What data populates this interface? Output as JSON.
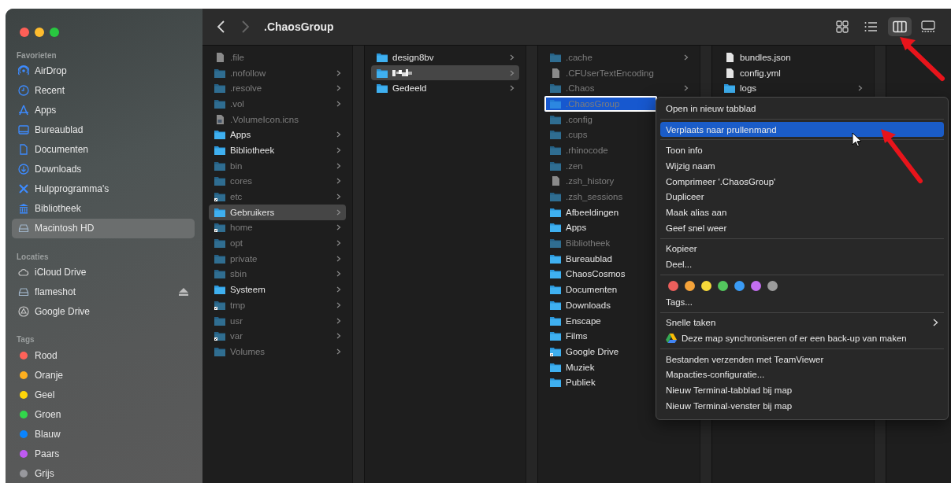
{
  "window": {
    "title": ".ChaosGroup"
  },
  "toolbar": {
    "back_enabled": true,
    "forward_enabled": false,
    "views": [
      {
        "kind": "icons",
        "selected": false
      },
      {
        "kind": "list",
        "selected": false
      },
      {
        "kind": "columns",
        "selected": true
      },
      {
        "kind": "gallery",
        "selected": false
      }
    ]
  },
  "sidebar": {
    "sections": [
      {
        "heading": "Favorieten",
        "items": [
          {
            "label": "AirDrop",
            "kind": "airdrop",
            "selected": false
          },
          {
            "label": "Recent",
            "kind": "recent",
            "selected": false
          },
          {
            "label": "Apps",
            "kind": "apps",
            "selected": false
          },
          {
            "label": "Bureaublad",
            "kind": "desktop",
            "selected": false
          },
          {
            "label": "Documenten",
            "kind": "document",
            "selected": false
          },
          {
            "label": "Downloads",
            "kind": "download",
            "selected": false
          },
          {
            "label": "Hulpprogramma's",
            "kind": "tools",
            "selected": false
          },
          {
            "label": "Bibliotheek",
            "kind": "library",
            "selected": false
          },
          {
            "label": "Macintosh HD",
            "kind": "disk",
            "selected": true
          }
        ]
      },
      {
        "heading": "Locaties",
        "items": [
          {
            "label": "iCloud Drive",
            "kind": "cloud",
            "selected": false,
            "ejectable": false
          },
          {
            "label": "flameshot",
            "kind": "disk",
            "selected": false,
            "ejectable": true
          },
          {
            "label": "Google Drive",
            "kind": "drive",
            "selected": false,
            "ejectable": false
          }
        ]
      },
      {
        "heading": "Tags",
        "items": [
          {
            "label": "Rood",
            "kind": "tag",
            "color": "#ff6259",
            "selected": false
          },
          {
            "label": "Oranje",
            "kind": "tag",
            "color": "#ffb01f",
            "selected": false
          },
          {
            "label": "Geel",
            "kind": "tag",
            "color": "#ffd60a",
            "selected": false
          },
          {
            "label": "Groen",
            "kind": "tag",
            "color": "#32d74b",
            "selected": false
          },
          {
            "label": "Blauw",
            "kind": "tag",
            "color": "#0a84ff",
            "selected": false
          },
          {
            "label": "Paars",
            "kind": "tag",
            "color": "#bf5af2",
            "selected": false
          },
          {
            "label": "Grijs",
            "kind": "tag",
            "color": "#98989d",
            "selected": false
          }
        ]
      }
    ]
  },
  "columns": [
    {
      "items": [
        {
          "name": ".file",
          "kind": "file",
          "dimmed": true,
          "alias": false,
          "has_children": false,
          "selected": false,
          "focused": false
        },
        {
          "name": ".nofollow",
          "kind": "folder",
          "dimmed": true,
          "alias": false,
          "has_children": true,
          "selected": false,
          "focused": false
        },
        {
          "name": ".resolve",
          "kind": "folder",
          "dimmed": true,
          "alias": false,
          "has_children": true,
          "selected": false,
          "focused": false
        },
        {
          "name": ".vol",
          "kind": "folder",
          "dimmed": true,
          "alias": false,
          "has_children": true,
          "selected": false,
          "focused": false
        },
        {
          "name": ".VolumeIcon.icns",
          "kind": "image-file",
          "dimmed": true,
          "alias": false,
          "has_children": false,
          "selected": false,
          "focused": false
        },
        {
          "name": "Apps",
          "kind": "folder",
          "dimmed": false,
          "alias": false,
          "has_children": true,
          "selected": false,
          "focused": false
        },
        {
          "name": "Bibliotheek",
          "kind": "folder",
          "dimmed": false,
          "alias": false,
          "has_children": true,
          "selected": false,
          "focused": false
        },
        {
          "name": "bin",
          "kind": "folder",
          "dimmed": true,
          "alias": false,
          "has_children": true,
          "selected": false,
          "focused": false
        },
        {
          "name": "cores",
          "kind": "folder",
          "dimmed": true,
          "alias": false,
          "has_children": true,
          "selected": false,
          "focused": false
        },
        {
          "name": "etc",
          "kind": "folder",
          "dimmed": true,
          "alias": true,
          "has_children": true,
          "selected": false,
          "focused": false
        },
        {
          "name": "Gebruikers",
          "kind": "folder",
          "dimmed": false,
          "alias": false,
          "has_children": true,
          "selected": true,
          "focused": false
        },
        {
          "name": "home",
          "kind": "folder",
          "dimmed": true,
          "alias": true,
          "has_children": true,
          "selected": false,
          "focused": false
        },
        {
          "name": "opt",
          "kind": "folder",
          "dimmed": true,
          "alias": false,
          "has_children": true,
          "selected": false,
          "focused": false
        },
        {
          "name": "private",
          "kind": "folder",
          "dimmed": true,
          "alias": false,
          "has_children": true,
          "selected": false,
          "focused": false
        },
        {
          "name": "sbin",
          "kind": "folder",
          "dimmed": true,
          "alias": false,
          "has_children": true,
          "selected": false,
          "focused": false
        },
        {
          "name": "Systeem",
          "kind": "folder",
          "dimmed": false,
          "alias": false,
          "has_children": true,
          "selected": false,
          "focused": false
        },
        {
          "name": "tmp",
          "kind": "folder",
          "dimmed": true,
          "alias": true,
          "has_children": true,
          "selected": false,
          "focused": false
        },
        {
          "name": "usr",
          "kind": "folder",
          "dimmed": true,
          "alias": false,
          "has_children": true,
          "selected": false,
          "focused": false
        },
        {
          "name": "var",
          "kind": "folder",
          "dimmed": true,
          "alias": true,
          "has_children": true,
          "selected": false,
          "focused": false
        },
        {
          "name": "Volumes",
          "kind": "folder",
          "dimmed": true,
          "alias": false,
          "has_children": true,
          "selected": false,
          "focused": false
        }
      ]
    },
    {
      "items": [
        {
          "name": "design8bv",
          "kind": "folder",
          "dimmed": false,
          "alias": false,
          "has_children": true,
          "selected": false,
          "focused": false
        },
        {
          "kind": "redacted-folder",
          "dimmed": false,
          "alias": false,
          "has_children": true,
          "selected": true,
          "focused": false
        },
        {
          "name": "Gedeeld",
          "kind": "folder",
          "dimmed": false,
          "alias": false,
          "has_children": true,
          "selected": false,
          "focused": false
        }
      ]
    },
    {
      "items": [
        {
          "name": ".cache",
          "kind": "folder",
          "dimmed": true,
          "alias": false,
          "has_children": true,
          "selected": false,
          "focused": false
        },
        {
          "name": ".CFUserTextEncoding",
          "kind": "file",
          "dimmed": true,
          "alias": false,
          "has_children": false,
          "selected": false,
          "focused": false
        },
        {
          "name": ".Chaos",
          "kind": "folder",
          "dimmed": true,
          "alias": false,
          "has_children": true,
          "selected": false,
          "focused": false
        },
        {
          "name": ".ChaosGroup",
          "kind": "folder",
          "dimmed": true,
          "alias": false,
          "has_children": false,
          "selected": true,
          "focused": true
        },
        {
          "name": ".config",
          "kind": "folder",
          "dimmed": true,
          "alias": false,
          "has_children": false,
          "selected": false,
          "focused": false
        },
        {
          "name": ".cups",
          "kind": "folder",
          "dimmed": true,
          "alias": false,
          "has_children": false,
          "selected": false,
          "focused": false
        },
        {
          "name": ".rhinocode",
          "kind": "folder",
          "dimmed": true,
          "alias": false,
          "has_children": false,
          "selected": false,
          "focused": false
        },
        {
          "name": ".zen",
          "kind": "folder",
          "dimmed": true,
          "alias": false,
          "has_children": false,
          "selected": false,
          "focused": false
        },
        {
          "name": ".zsh_history",
          "kind": "file",
          "dimmed": true,
          "alias": false,
          "has_children": false,
          "selected": false,
          "focused": false
        },
        {
          "name": ".zsh_sessions",
          "kind": "folder",
          "dimmed": true,
          "alias": false,
          "has_children": false,
          "selected": false,
          "focused": false
        },
        {
          "name": "Afbeeldingen",
          "kind": "folder",
          "dimmed": false,
          "alias": false,
          "has_children": false,
          "selected": false,
          "focused": false
        },
        {
          "name": "Apps",
          "kind": "folder",
          "dimmed": false,
          "alias": false,
          "has_children": false,
          "selected": false,
          "focused": false
        },
        {
          "name": "Bibliotheek",
          "kind": "folder",
          "dimmed": true,
          "alias": false,
          "has_children": false,
          "selected": false,
          "focused": false
        },
        {
          "name": "Bureaublad",
          "kind": "folder",
          "dimmed": false,
          "alias": false,
          "has_children": false,
          "selected": false,
          "focused": false
        },
        {
          "name": "ChaosCosmos",
          "kind": "folder",
          "dimmed": false,
          "alias": false,
          "has_children": false,
          "selected": false,
          "focused": false
        },
        {
          "name": "Documenten",
          "kind": "folder",
          "dimmed": false,
          "alias": false,
          "has_children": false,
          "selected": false,
          "focused": false
        },
        {
          "name": "Downloads",
          "kind": "folder",
          "dimmed": false,
          "alias": false,
          "has_children": false,
          "selected": false,
          "focused": false
        },
        {
          "name": "Enscape",
          "kind": "folder",
          "dimmed": false,
          "alias": false,
          "has_children": false,
          "selected": false,
          "focused": false
        },
        {
          "name": "Films",
          "kind": "folder",
          "dimmed": false,
          "alias": false,
          "has_children": false,
          "selected": false,
          "focused": false
        },
        {
          "name": "Google Drive",
          "kind": "folder",
          "dimmed": false,
          "alias": true,
          "has_children": false,
          "selected": false,
          "focused": false
        },
        {
          "name": "Muziek",
          "kind": "folder",
          "dimmed": false,
          "alias": false,
          "has_children": false,
          "selected": false,
          "focused": false
        },
        {
          "name": "Publiek",
          "kind": "folder",
          "dimmed": false,
          "alias": false,
          "has_children": false,
          "selected": false,
          "focused": false
        }
      ]
    },
    {
      "items": [
        {
          "name": "bundles.json",
          "kind": "file",
          "dimmed": false,
          "alias": false,
          "has_children": false,
          "selected": false,
          "focused": false
        },
        {
          "name": "config.yml",
          "kind": "file",
          "dimmed": false,
          "alias": false,
          "has_children": false,
          "selected": false,
          "focused": false
        },
        {
          "name": "logs",
          "kind": "folder",
          "dimmed": false,
          "alias": false,
          "has_children": true,
          "selected": false,
          "focused": false
        }
      ]
    }
  ],
  "context_menu": {
    "groups": [
      [
        {
          "kind": "action",
          "label": "Open in nieuw tabblad",
          "selected": false
        }
      ],
      [
        {
          "kind": "action",
          "label": "Verplaats naar prullenmand",
          "selected": true
        }
      ],
      [
        {
          "kind": "action",
          "label": "Toon info",
          "selected": false
        },
        {
          "kind": "action",
          "label": "Wijzig naam",
          "selected": false
        },
        {
          "kind": "action",
          "label": "Comprimeer '.ChaosGroup'",
          "selected": false
        },
        {
          "kind": "action",
          "label": "Dupliceer",
          "selected": false
        },
        {
          "kind": "action",
          "label": "Maak alias aan",
          "selected": false
        },
        {
          "kind": "action",
          "label": "Geef snel weer",
          "selected": false
        }
      ],
      [
        {
          "kind": "action",
          "label": "Kopieer",
          "selected": false
        },
        {
          "kind": "action",
          "label": "Deel...",
          "selected": false
        }
      ],
      [
        {
          "kind": "tag-colors",
          "tags": [
            {
              "color": "#ec5f5c"
            },
            {
              "color": "#f5a33a"
            },
            {
              "color": "#f7d93a"
            },
            {
              "color": "#53c65d"
            },
            {
              "color": "#3a9bf5"
            },
            {
              "color": "#c46ef0"
            },
            {
              "color": "#9b9b9b"
            }
          ]
        },
        {
          "kind": "action",
          "label": "Tags...",
          "selected": false
        }
      ],
      [
        {
          "kind": "submenu",
          "label": "Snelle taken",
          "selected": false
        },
        {
          "kind": "drive-action",
          "label": "Deze map synchroniseren of er een back-up van maken",
          "selected": false
        }
      ],
      [
        {
          "kind": "action",
          "label": "Bestanden verzenden met TeamViewer",
          "selected": false
        },
        {
          "kind": "action",
          "label": "Mapacties-configuratie...",
          "selected": false
        },
        {
          "kind": "action",
          "label": "Nieuw Terminal-tabblad bij map",
          "selected": false
        },
        {
          "kind": "action",
          "label": "Nieuw Terminal-venster bij map",
          "selected": false
        }
      ]
    ]
  }
}
